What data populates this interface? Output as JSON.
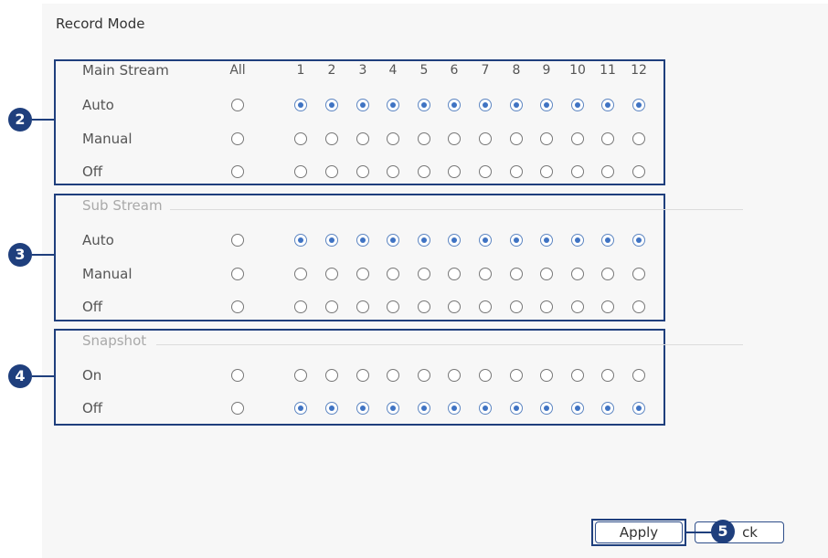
{
  "page": {
    "title": "Record Mode"
  },
  "columns": [
    "All",
    "1",
    "2",
    "3",
    "4",
    "5",
    "6",
    "7",
    "8",
    "9",
    "10",
    "11",
    "12"
  ],
  "sections": [
    {
      "name": "Main Stream",
      "callout": "2",
      "rows": [
        {
          "label": "Auto",
          "all": false,
          "channels": [
            true,
            true,
            true,
            true,
            true,
            true,
            true,
            true,
            true,
            true,
            true,
            true
          ]
        },
        {
          "label": "Manual",
          "all": false,
          "channels": [
            false,
            false,
            false,
            false,
            false,
            false,
            false,
            false,
            false,
            false,
            false,
            false
          ]
        },
        {
          "label": "Off",
          "all": false,
          "channels": [
            false,
            false,
            false,
            false,
            false,
            false,
            false,
            false,
            false,
            false,
            false,
            false
          ]
        }
      ]
    },
    {
      "name": "Sub Stream",
      "callout": "3",
      "rows": [
        {
          "label": "Auto",
          "all": false,
          "channels": [
            true,
            true,
            true,
            true,
            true,
            true,
            true,
            true,
            true,
            true,
            true,
            true
          ]
        },
        {
          "label": "Manual",
          "all": false,
          "channels": [
            false,
            false,
            false,
            false,
            false,
            false,
            false,
            false,
            false,
            false,
            false,
            false
          ]
        },
        {
          "label": "Off",
          "all": false,
          "channels": [
            false,
            false,
            false,
            false,
            false,
            false,
            false,
            false,
            false,
            false,
            false,
            false
          ]
        }
      ]
    },
    {
      "name": "Snapshot",
      "callout": "4",
      "rows": [
        {
          "label": "On",
          "all": false,
          "channels": [
            false,
            false,
            false,
            false,
            false,
            false,
            false,
            false,
            false,
            false,
            false,
            false
          ]
        },
        {
          "label": "Off",
          "all": false,
          "channels": [
            true,
            true,
            true,
            true,
            true,
            true,
            true,
            true,
            true,
            true,
            true,
            true
          ]
        }
      ]
    }
  ],
  "buttons": {
    "apply": "Apply",
    "back": "ck"
  },
  "callout_buttons": "5",
  "colors": {
    "accent": "#1f3f7d",
    "radio_dot": "#3f73c3",
    "panel_bg": "#f7f7f7"
  }
}
